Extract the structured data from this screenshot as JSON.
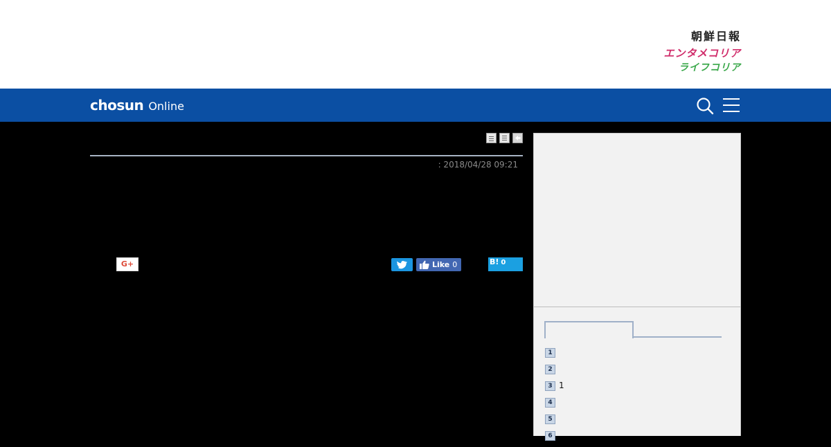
{
  "header": {
    "brand_links": [
      "朝鮮日報",
      "エンタメコリア",
      "ライフコリア"
    ]
  },
  "navbar": {
    "logo_main": "chosun",
    "logo_sub": "Online",
    "icons": [
      "search-icon",
      "hamburger-menu-icon"
    ],
    "color": "#0b4fa3"
  },
  "article": {
    "tools": [
      "print-icon",
      "list-icon",
      "back-icon"
    ],
    "date": ": 2018/04/28 09:21",
    "share": {
      "gplus_label": "G+",
      "facebook_label": "Like",
      "facebook_count": "0",
      "hatena_label": "B!",
      "hatena_count": "0"
    }
  },
  "sidebar": {
    "tabs": [
      "",
      ""
    ],
    "ranking": [
      {
        "rank": "1",
        "title": ""
      },
      {
        "rank": "2",
        "title": ""
      },
      {
        "rank": "3",
        "title": "1"
      },
      {
        "rank": "4",
        "title": ""
      },
      {
        "rank": "5",
        "title": ""
      },
      {
        "rank": "6",
        "title": ""
      }
    ]
  }
}
